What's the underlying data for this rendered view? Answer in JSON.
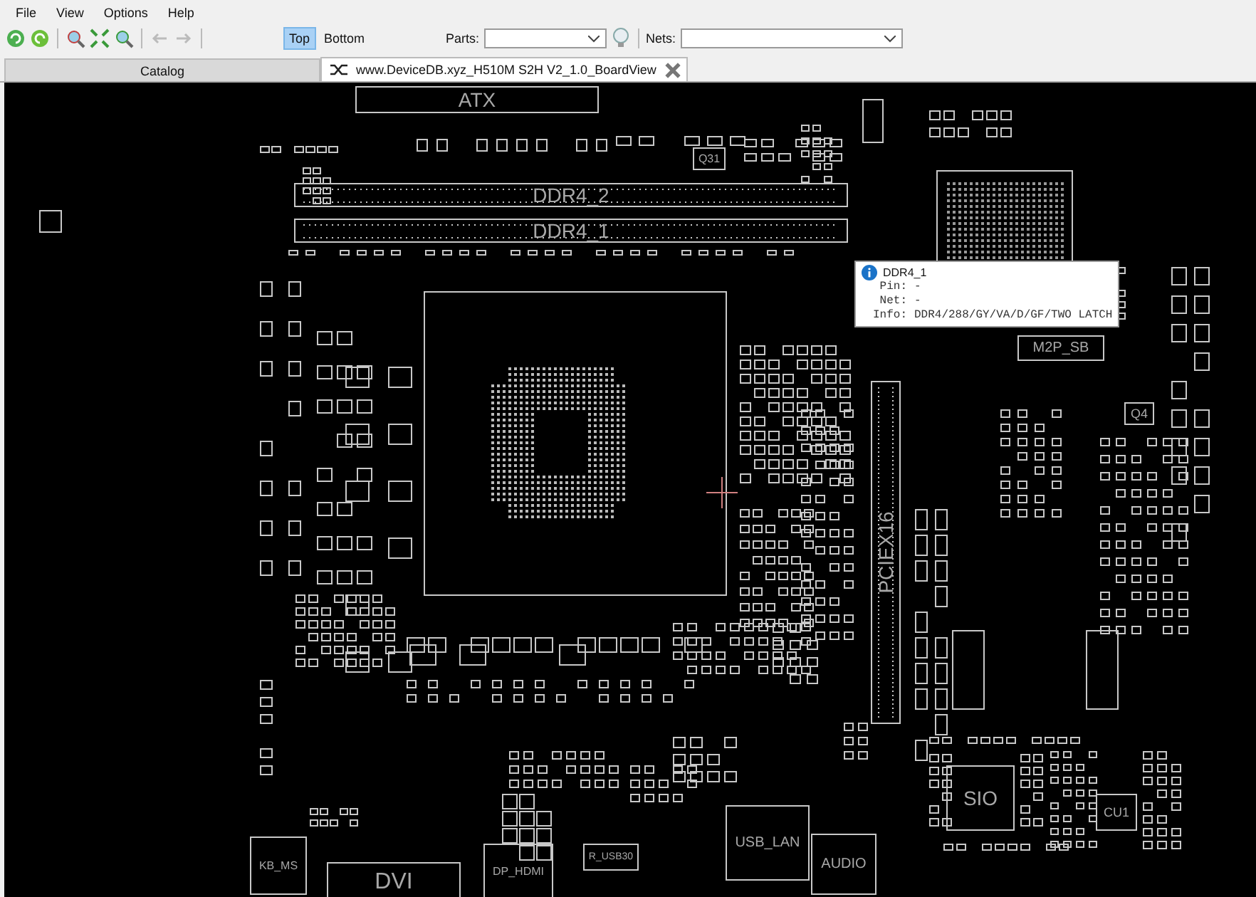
{
  "menu": [
    "File",
    "View",
    "Options",
    "Help"
  ],
  "side_toggle": [
    {
      "label": "Top",
      "selected": true
    },
    {
      "label": "Bottom",
      "selected": false
    }
  ],
  "parts": {
    "label": "Parts:"
  },
  "nets": {
    "label": "Nets:"
  },
  "tabs": [
    {
      "label": "Catalog",
      "selected": false,
      "closable": false
    },
    {
      "label": "www.DeviceDB.xyz_H510M S2H V2_1.0_BoardView",
      "selected": true,
      "closable": true
    }
  ],
  "board": {
    "labels": [
      "ATX",
      "DDR4_2",
      "DDR4_1",
      "PCIEX16",
      "M2P_SB",
      "Q4",
      "SIO",
      "CU1",
      "KB_MS",
      "DVI",
      "DP_HDMI",
      "USB_LAN",
      "AUDIO",
      "R_USB30",
      "Q31"
    ]
  },
  "tooltip": {
    "title": "DDR4_1",
    "lines": [
      {
        "key": "Pin:",
        "value": "-"
      },
      {
        "key": "Net:",
        "value": "-"
      },
      {
        "key": "Info:",
        "value": "DDR4/288/GY/VA/D/GF/TWO LATCH"
      }
    ]
  }
}
